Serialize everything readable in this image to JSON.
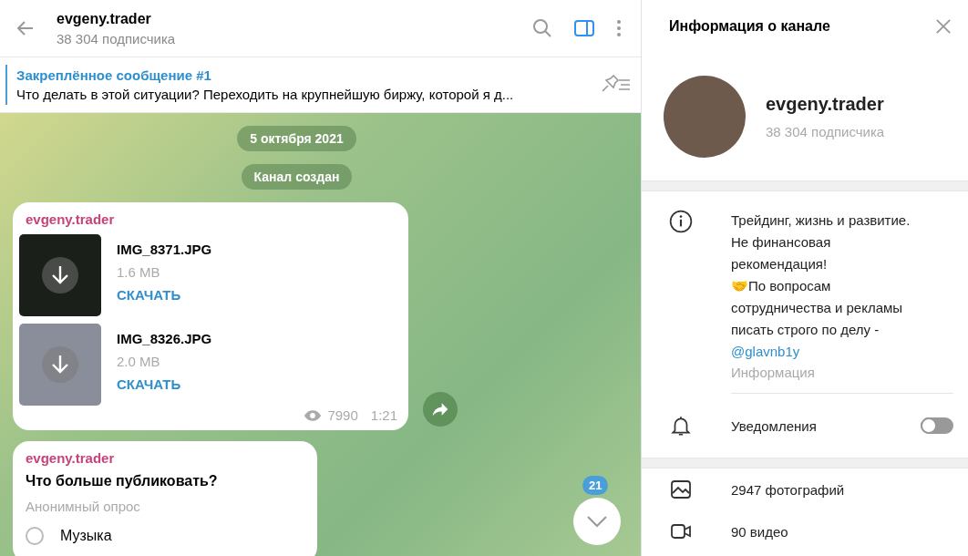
{
  "header": {
    "title": "evgeny.trader",
    "subtitle": "38 304 подписчика",
    "sidebar_open": true
  },
  "pinned": {
    "title": "Закреплённое сообщение #1",
    "text": "Что делать в этой ситуации? Переходить на крупнейшую биржу, которой я д..."
  },
  "service_messages": [
    "5 октября 2021",
    "Канал создан"
  ],
  "files_message": {
    "author": "evgeny.trader",
    "files": [
      {
        "name": "IMG_8371.JPG",
        "size": "1.6 MB",
        "action": "СКАЧАТЬ"
      },
      {
        "name": "IMG_8326.JPG",
        "size": "2.0 MB",
        "action": "СКАЧАТЬ"
      }
    ],
    "views": "7990",
    "time": "1:21"
  },
  "poll_message": {
    "author": "evgeny.trader",
    "question": "Что больше публиковать?",
    "type": "Анонимный опрос",
    "options": [
      {
        "label": "Музыка",
        "selected": false
      }
    ]
  },
  "unread_badge": "21",
  "info_panel": {
    "title": "Информация о канале",
    "name": "evgeny.trader",
    "subtitle": "38 304 подписчика",
    "description": "Трейдинг, жизнь и развитие.\nНе финансовая\nрекомендация!\n🤝По вопросам\nсотрудничества и рекламы\nписать строго по делу -",
    "link": "@glavnb1y",
    "description_label": "Информация",
    "notifications": {
      "label": "Уведомления",
      "on": false
    },
    "media": [
      {
        "kind": "photos",
        "label": "2947 фотографий"
      },
      {
        "kind": "videos",
        "label": "90 видео"
      }
    ]
  }
}
